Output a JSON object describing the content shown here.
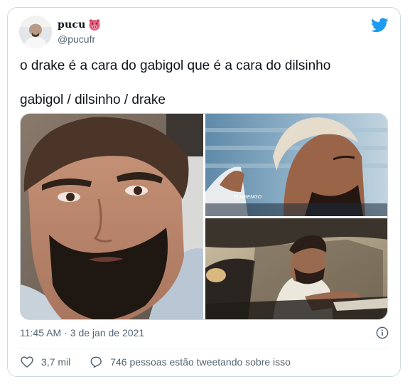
{
  "author": {
    "display_name": "pucu",
    "handle": "@pucufr",
    "name_emoji": "pig-face-emoji"
  },
  "tweet": {
    "line1": "o drake é a cara do gabigol que é a cara do dilsinho",
    "line2": "gabigol / dilsinho / drake"
  },
  "media": {
    "photos": [
      "photo-drake",
      "photo-gabigol",
      "photo-dilsinho"
    ],
    "watermark": "FLAMENGO"
  },
  "meta": {
    "time": "11:45 AM",
    "separator": "·",
    "date": "3 de jan de 2021"
  },
  "actions": {
    "likes": "3,7 mil",
    "conversation": "746 pessoas estão tweetando sobre isso"
  },
  "colors": {
    "twitter_blue": "#1d9bf0",
    "text_primary": "#0f1419",
    "text_secondary": "#536471",
    "border": "#cfd9de"
  },
  "icons": {
    "brand": "twitter-bird-icon",
    "info": "info-icon",
    "like": "heart-icon",
    "reply": "speech-bubble-icon"
  }
}
